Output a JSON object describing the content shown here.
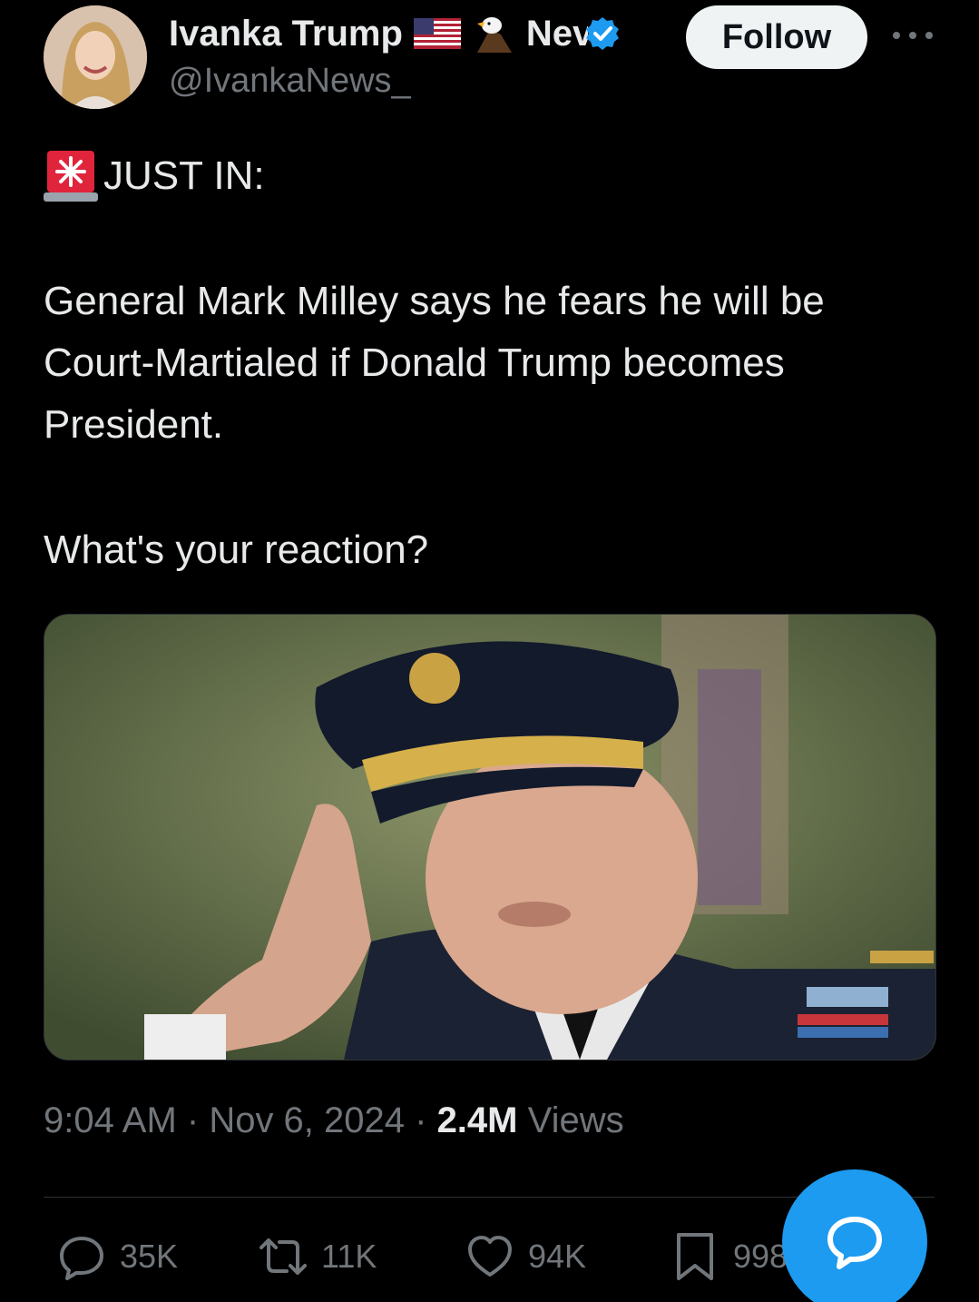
{
  "author": {
    "display_name": "Ivanka Trump",
    "name_suffix": "Nev",
    "handle": "@IvankaNews_",
    "verified": true,
    "avatar": "profile-photo"
  },
  "header": {
    "follow_label": "Follow",
    "more_icon": "more-horizontal-icon"
  },
  "tweet": {
    "alert_label": "JUST IN:",
    "body": "General Mark Milley says he fears he will be Court-Martialed if Donald Trump becomes President.",
    "question": "What's your reaction?",
    "media_alt": "Photo of a saluting general"
  },
  "meta": {
    "time": "9:04 AM",
    "separator": " · ",
    "date": "Nov 6, 2024",
    "views_count": "2.4M",
    "views_label": "Views"
  },
  "actions": {
    "replies": "35K",
    "reposts": "11K",
    "likes": "94K",
    "bookmarks": "998"
  },
  "colors": {
    "background": "#000000",
    "text_primary": "#e7e9ea",
    "text_secondary": "#71767b",
    "accent": "#1d9bf0",
    "divider": "#2f3336"
  }
}
